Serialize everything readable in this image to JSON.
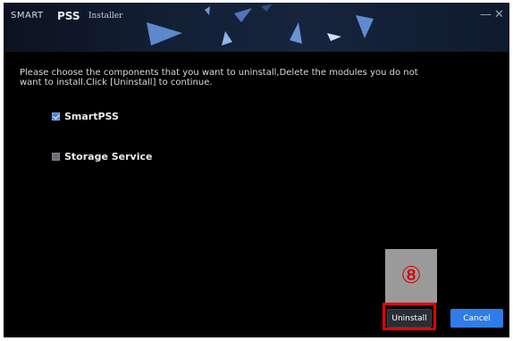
{
  "titlebar": {
    "brand_smart": "SMART",
    "brand_pss": "PSS",
    "brand_installer": "Installer",
    "minimize_glyph": "—",
    "close_glyph": "✕"
  },
  "instructions": "Please choose the components that you want to uninstall,Delete the modules you do not want to install.Click [Uninstall] to continue.",
  "components": [
    {
      "label": "SmartPSS",
      "checked": true
    },
    {
      "label": "Storage Service",
      "checked": false
    }
  ],
  "annotation": {
    "step_marker": "⑧"
  },
  "buttons": {
    "uninstall": "Uninstall",
    "cancel": "Cancel"
  },
  "colors": {
    "accent": "#2f7de5",
    "highlight": "#e60000",
    "callout_bg": "#9a9a9a",
    "callout_text": "#d40000"
  }
}
